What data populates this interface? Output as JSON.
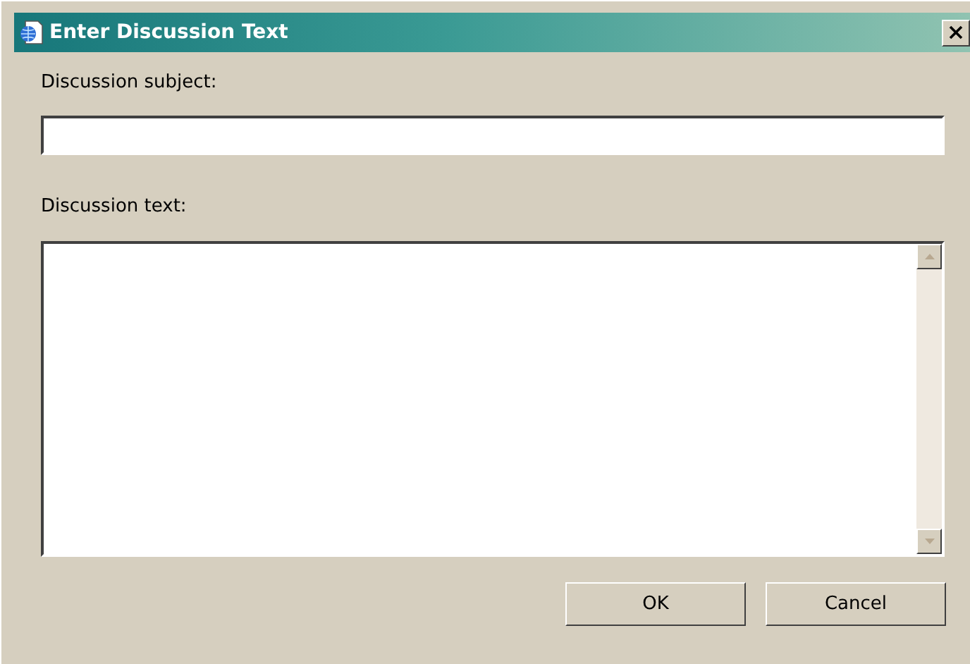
{
  "window": {
    "title": "Enter Discussion Text"
  },
  "subject": {
    "label": "Discussion subject:"
  },
  "text": {
    "label": "Discussion text:"
  },
  "buttons": [
    {
      "label": "OK"
    },
    {
      "label": "Cancel"
    }
  ]
}
